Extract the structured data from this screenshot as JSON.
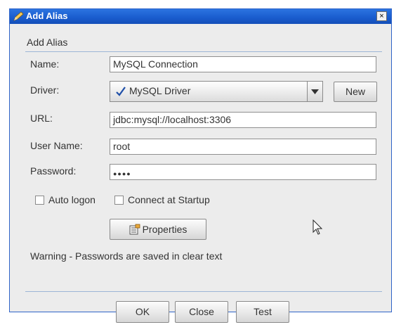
{
  "window": {
    "title": "Add Alias",
    "close_glyph": "×"
  },
  "section": {
    "header": "Add Alias"
  },
  "form": {
    "name_label": "Name:",
    "name_value": "MySQL Connection",
    "driver_label": "Driver:",
    "driver_value": "MySQL Driver",
    "new_button": "New",
    "url_label": "URL:",
    "url_value": "jdbc:mysql://localhost:3306",
    "username_label": "User Name:",
    "username_value": "root",
    "password_label": "Password:",
    "password_value": "●●●●",
    "auto_logon_label": "Auto logon",
    "connect_startup_label": "Connect at Startup",
    "properties_button": "Properties"
  },
  "warning": "Warning - Passwords are saved in clear text",
  "buttons": {
    "ok": "OK",
    "close": "Close",
    "test": "Test"
  },
  "icons": {
    "title": "pencil-icon",
    "driver": "checkmark-icon",
    "properties": "properties-icon",
    "dropdown": "chevron-down-icon",
    "pointer": "mouse-pointer-icon"
  },
  "colors": {
    "titlebar": "#1a5dcf",
    "window_bg": "#ececec",
    "divider": "#9db6d6"
  }
}
